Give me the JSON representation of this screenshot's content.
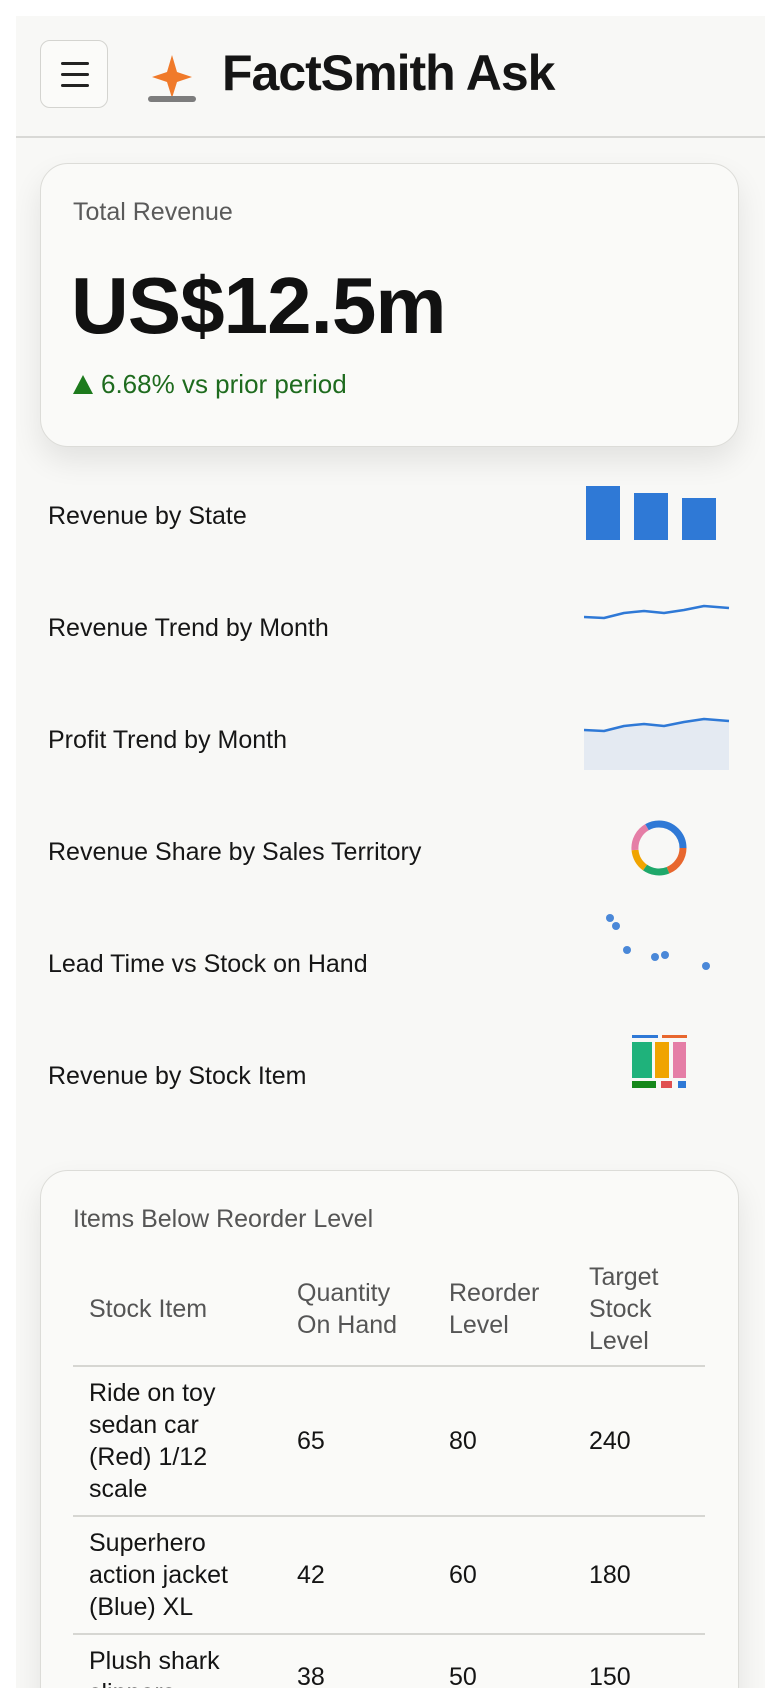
{
  "app": {
    "title": "FactSmith Ask",
    "accent_color": "#f07a2a",
    "logo_icon": "sparkle-on-bar-icon",
    "menu_icon": "hamburger-menu-icon"
  },
  "kpi": {
    "label": "Total Revenue",
    "value": "US$12.5m",
    "delta_text": "6.68% vs prior period",
    "delta_direction": "up",
    "delta_color": "#1d7a1d"
  },
  "charts_list": [
    {
      "label": "Revenue by State",
      "thumbnail": "bar"
    },
    {
      "label": "Revenue Trend by Month",
      "thumbnail": "line"
    },
    {
      "label": "Profit Trend by Month",
      "thumbnail": "area"
    },
    {
      "label": "Revenue Share by Sales Territory",
      "thumbnail": "donut"
    },
    {
      "label": "Lead Time vs Stock on Hand",
      "thumbnail": "scatter"
    },
    {
      "label": "Revenue by Stock Item",
      "thumbnail": "stacked-bar"
    }
  ],
  "table": {
    "title": "Items Below Reorder Level",
    "columns": [
      "Stock Item",
      "Quantity On Hand",
      "Reorder Level",
      "Target Stock Level"
    ],
    "rows": [
      [
        "Ride on toy sedan car (Red) 1/12 scale",
        "65",
        "80",
        "240"
      ],
      [
        "Superhero action jacket (Blue) XL",
        "42",
        "60",
        "180"
      ],
      [
        "Plush shark slippers",
        "38",
        "50",
        "150"
      ]
    ]
  }
}
